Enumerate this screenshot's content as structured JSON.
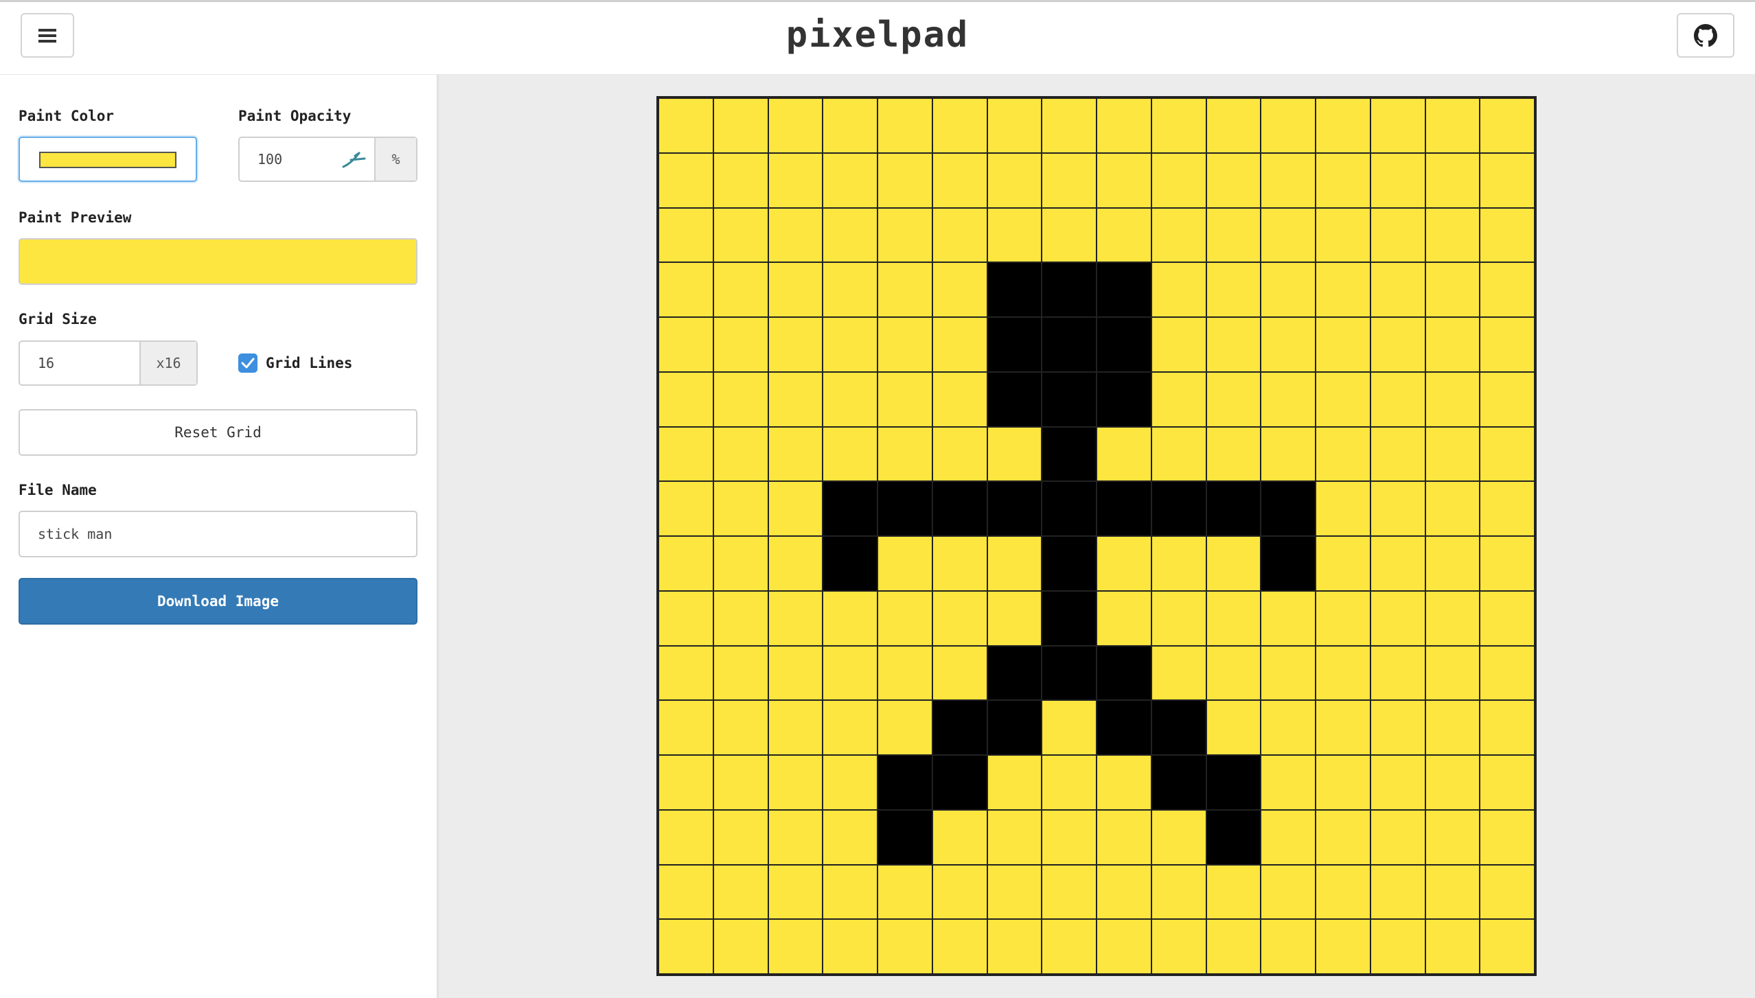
{
  "app": {
    "title": "pixelpad"
  },
  "header": {
    "menu_icon": "hamburger-menu-icon",
    "github_icon": "github-icon"
  },
  "sidebar": {
    "paint_color": {
      "label": "Paint Color",
      "value": "#fde63f"
    },
    "paint_opacity": {
      "label": "Paint Opacity",
      "value": "100",
      "unit": "%"
    },
    "paint_preview": {
      "label": "Paint Preview"
    },
    "grid_size": {
      "label": "Grid Size",
      "value": "16",
      "suffix": "x16"
    },
    "grid_lines": {
      "label": "Grid Lines",
      "checked": true
    },
    "reset_button": "Reset Grid",
    "file_name": {
      "label": "File Name",
      "value": "stick man"
    },
    "download_button": "Download Image"
  },
  "colors": {
    "paint": "#fde63f",
    "ink": "#000000",
    "accent": "#337ab7"
  },
  "canvas": {
    "size": 16,
    "palette": {
      "Y": "#fde63f",
      "K": "#000000"
    },
    "rows": [
      "YYYYYYYYYYYYYYYY",
      "YYYYYYYYYYYYYYYY",
      "YYYYYYYYYYYYYYYY",
      "YYYYYYKKKYYYYYYY",
      "YYYYYYKKKYYYYYYY",
      "YYYYYYKKKYYYYYYY",
      "YYYYYYYKYYYYYYYY",
      "YYYKKKKKKKKKYYYY",
      "YYYKYYYKYYYKYYYY",
      "YYYYYYYKYYYYYYYY",
      "YYYYYYKKKYYYYYYY",
      "YYYYYKKYKKYYYYYY",
      "YYYYKKYYYKKYYYYY",
      "YYYYKYYYYYKYYYYY",
      "YYYYYYYYYYYYYYYY",
      "YYYYYYYYYYYYYYYY"
    ]
  }
}
